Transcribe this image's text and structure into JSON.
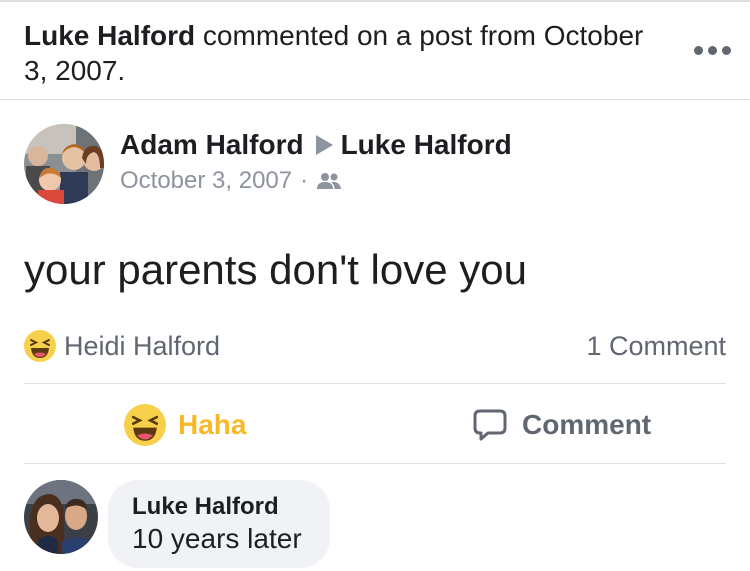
{
  "activity": {
    "actor": "Luke Halford",
    "text": " commented on a post from October 3, 2007."
  },
  "post": {
    "author": "Adam Halford",
    "recipient": "Luke Halford",
    "date": "October 3, 2007",
    "separator": "·",
    "audience_icon": "friends-icon",
    "body": "your parents don't love you"
  },
  "reactions": {
    "icon": "haha-emoji-icon",
    "reactor": "Heidi Halford",
    "comment_count": "1 Comment"
  },
  "actions": {
    "haha_label": "Haha",
    "comment_label": "Comment"
  },
  "comment": {
    "author": "Luke Halford",
    "text": "10 years later"
  },
  "colors": {
    "haha_yellow": "#f7b928",
    "bubble_bg": "#f0f2f5",
    "secondary_text": "#606770",
    "meta_text": "#8d949e",
    "divider": "#dddfe2"
  }
}
